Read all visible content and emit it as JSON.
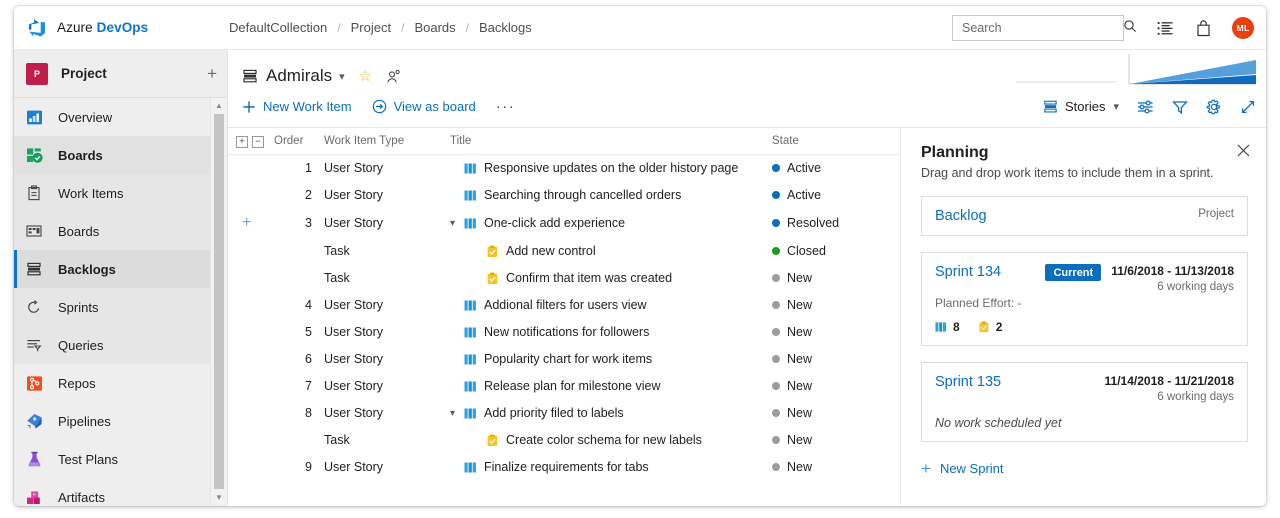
{
  "brand": {
    "name_light": "Azure ",
    "name_bold": "DevOps",
    "logo_icon": "azure-devops-logo"
  },
  "breadcrumb": {
    "items": [
      "DefaultCollection",
      "Project",
      "Boards",
      "Backlogs"
    ],
    "separator": "/"
  },
  "search": {
    "placeholder": "Search",
    "value": "",
    "icon": "search-icon"
  },
  "top_actions": [
    {
      "name": "marketplace-icon",
      "glyph": "list-icon"
    },
    {
      "name": "shopping-bag-icon",
      "glyph": "bag-icon"
    }
  ],
  "user": {
    "initials": "ML",
    "color": "#e8400f"
  },
  "sidebar": {
    "project": {
      "badge": "P",
      "name": "Project",
      "add_label": "+",
      "badge_color": "#bf1e4b"
    },
    "items": [
      {
        "label": "Overview",
        "icon": "overview-icon",
        "level": "top",
        "selected": false
      },
      {
        "label": "Boards",
        "icon": "boards-group-icon",
        "level": "group",
        "selected": false
      },
      {
        "label": "Work Items",
        "icon": "work-items-icon",
        "level": "sub",
        "selected": false
      },
      {
        "label": "Boards",
        "icon": "board-icon",
        "level": "sub",
        "selected": false
      },
      {
        "label": "Backlogs",
        "icon": "backlogs-icon",
        "level": "sub",
        "selected": true
      },
      {
        "label": "Sprints",
        "icon": "sprints-icon",
        "level": "sub",
        "selected": false
      },
      {
        "label": "Queries",
        "icon": "queries-icon",
        "level": "sub",
        "selected": false
      },
      {
        "label": "Repos",
        "icon": "repos-icon",
        "level": "top",
        "selected": false
      },
      {
        "label": "Pipelines",
        "icon": "pipelines-icon",
        "level": "top",
        "selected": false
      },
      {
        "label": "Test Plans",
        "icon": "test-plans-icon",
        "level": "top",
        "selected": false
      },
      {
        "label": "Artifacts",
        "icon": "artifacts-icon",
        "level": "top",
        "selected": false
      }
    ]
  },
  "header": {
    "team_name": "Admirals",
    "team_icon": "backlog-icon",
    "chevron": "⌄",
    "favorite_icon": "star-icon",
    "team_members_icon": "people-icon"
  },
  "toolbar": {
    "new_work_item": "New Work Item",
    "view_as_board": "View as board",
    "more": "···",
    "level_selector": "Stories",
    "right_icons": [
      "column-options-icon",
      "filter-icon",
      "settings-icon",
      "fullscreen-icon"
    ]
  },
  "grid": {
    "expand_all": "+",
    "collapse_all": "−",
    "columns": [
      "Order",
      "Work Item Type",
      "Title",
      "State"
    ],
    "rows": [
      {
        "order": "1",
        "type": "User Story",
        "title": "Responsive updates on the older history page",
        "state": "Active",
        "state_color": "#0a6ebd",
        "icon": "user-story-icon",
        "indent": 0,
        "chevron": "",
        "add_child": false
      },
      {
        "order": "2",
        "type": "User Story",
        "title": "Searching through cancelled orders",
        "state": "Active",
        "state_color": "#0a6ebd",
        "icon": "user-story-icon",
        "indent": 0,
        "chevron": "",
        "add_child": false
      },
      {
        "order": "3",
        "type": "User Story",
        "title": "One-click add experience",
        "state": "Resolved",
        "state_color": "#0a6ebd",
        "icon": "user-story-icon",
        "indent": 0,
        "chevron": "⌄",
        "add_child": true
      },
      {
        "order": "",
        "type": "Task",
        "title": "Add new control",
        "state": "Closed",
        "state_color": "#1d9b1d",
        "icon": "task-icon",
        "indent": 1,
        "chevron": "",
        "add_child": false
      },
      {
        "order": "",
        "type": "Task",
        "title": "Confirm that item was created",
        "state": "New",
        "state_color": "#9c9c9c",
        "icon": "task-icon",
        "indent": 1,
        "chevron": "",
        "add_child": false
      },
      {
        "order": "4",
        "type": "User Story",
        "title": "Addional filters for users view",
        "state": "New",
        "state_color": "#9c9c9c",
        "icon": "user-story-icon",
        "indent": 0,
        "chevron": "",
        "add_child": false
      },
      {
        "order": "5",
        "type": "User Story",
        "title": "New notifications for followers",
        "state": "New",
        "state_color": "#9c9c9c",
        "icon": "user-story-icon",
        "indent": 0,
        "chevron": "",
        "add_child": false
      },
      {
        "order": "6",
        "type": "User Story",
        "title": "Popularity chart for work items",
        "state": "New",
        "state_color": "#9c9c9c",
        "icon": "user-story-icon",
        "indent": 0,
        "chevron": "",
        "add_child": false
      },
      {
        "order": "7",
        "type": "User Story",
        "title": "Release plan for milestone view",
        "state": "New",
        "state_color": "#9c9c9c",
        "icon": "user-story-icon",
        "indent": 0,
        "chevron": "",
        "add_child": false
      },
      {
        "order": "8",
        "type": "User Story",
        "title": "Add priority filed to labels",
        "state": "New",
        "state_color": "#9c9c9c",
        "icon": "user-story-icon",
        "indent": 0,
        "chevron": "⌄",
        "add_child": false
      },
      {
        "order": "",
        "type": "Task",
        "title": "Create color schema for new labels",
        "state": "New",
        "state_color": "#9c9c9c",
        "icon": "task-icon",
        "indent": 1,
        "chevron": "",
        "add_child": false
      },
      {
        "order": "9",
        "type": "User Story",
        "title": "Finalize requirements for tabs",
        "state": "New",
        "state_color": "#9c9c9c",
        "icon": "user-story-icon",
        "indent": 0,
        "chevron": "",
        "add_child": false
      }
    ]
  },
  "planning": {
    "title": "Planning",
    "subtitle": "Drag and drop work items to include them in a sprint.",
    "close_icon": "close-icon",
    "backlog": {
      "label": "Backlog",
      "scope": "Project"
    },
    "sprints": [
      {
        "name": "Sprint 134",
        "badge": "Current",
        "dates": "11/6/2018 - 11/13/2018",
        "working_days": "6 working days",
        "planned_effort": "Planned Effort: -",
        "counts": [
          {
            "icon": "user-story-icon",
            "value": "8"
          },
          {
            "icon": "task-icon",
            "value": "2"
          }
        ],
        "empty_text": ""
      },
      {
        "name": "Sprint 135",
        "badge": "",
        "dates": "11/14/2018 - 11/21/2018",
        "working_days": "6 working days",
        "planned_effort": "",
        "counts": [],
        "empty_text": "No work scheduled yet"
      }
    ],
    "new_sprint": "New Sprint"
  },
  "colors": {
    "accent": "#0a6ebd",
    "brand_blue": "#0a73d4",
    "state_active": "#0a6ebd",
    "state_closed": "#1d9b1d",
    "state_new": "#9c9c9c",
    "current_badge": "#0a6ebd"
  }
}
